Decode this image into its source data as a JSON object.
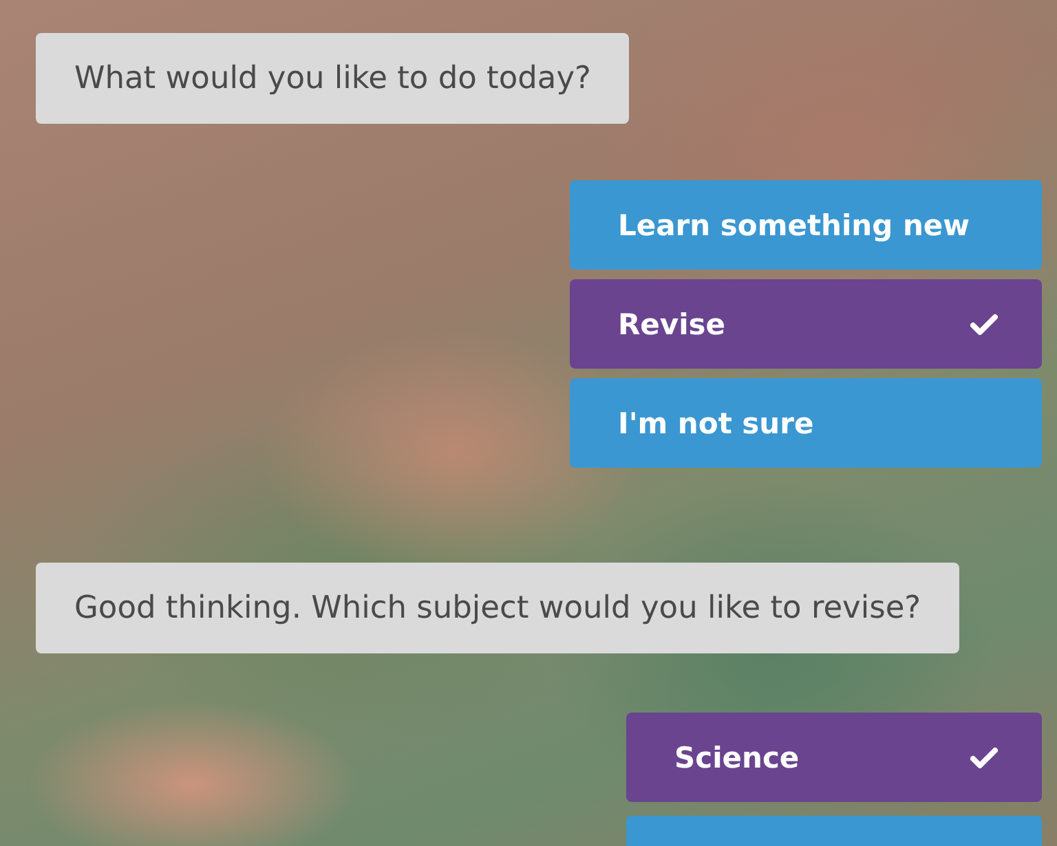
{
  "conversation": [
    {
      "kind": "bot_message",
      "text": "What would you like to do today?"
    },
    {
      "kind": "choices",
      "options": [
        {
          "label": "Learn something new",
          "selected": false
        },
        {
          "label": "Revise",
          "selected": true
        },
        {
          "label": "I'm not sure",
          "selected": false
        }
      ]
    },
    {
      "kind": "bot_message",
      "text": "Good thinking. Which subject would you like to revise?"
    },
    {
      "kind": "choices",
      "options": [
        {
          "label": "Science",
          "selected": true
        },
        {
          "selected": false
        }
      ]
    }
  ]
}
